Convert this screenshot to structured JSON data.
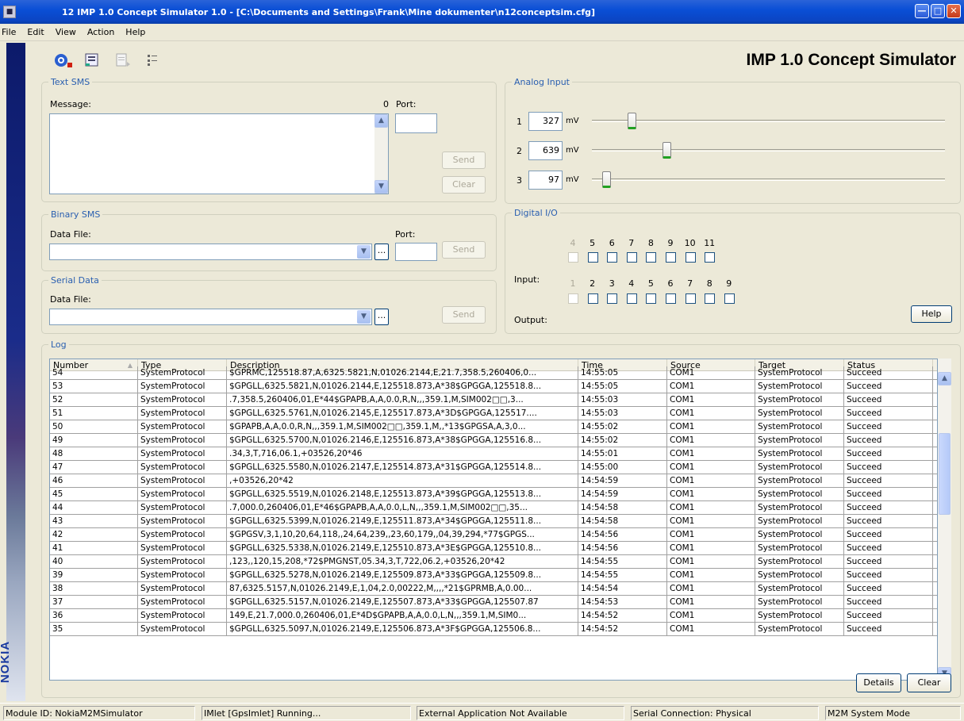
{
  "window": {
    "title": "12 IMP 1.0 Concept Simulator 1.0 - [C:\\Documents and Settings\\Frank\\Mine dokumenter\\n12conceptsim.cfg]"
  },
  "menu": [
    "File",
    "Edit",
    "View",
    "Action",
    "Help"
  ],
  "toolbar": {
    "icons": [
      "record-icon",
      "save-config-icon",
      "document-icon",
      "list-icon"
    ]
  },
  "app_heading": "IMP 1.0 Concept Simulator",
  "text_sms": {
    "legend": "Text SMS",
    "message_label": "Message:",
    "char_count": "0",
    "port_label": "Port:",
    "port_value": "",
    "message_value": "",
    "send": "Send",
    "clear": "Clear"
  },
  "binary_sms": {
    "legend": "Binary SMS",
    "data_file_label": "Data File:",
    "port_label": "Port:",
    "send": "Send",
    "dots": "..."
  },
  "serial_data": {
    "legend": "Serial Data",
    "data_file_label": "Data File:",
    "send": "Send",
    "dots": "..."
  },
  "analog_input": {
    "legend": "Analog Input",
    "unit": "mV",
    "channels": [
      {
        "id": "1",
        "value": "327",
        "level": 0.1
      },
      {
        "id": "2",
        "value": "639",
        "level": 0.2
      },
      {
        "id": "3",
        "value": "97",
        "level": 0.03
      }
    ]
  },
  "digital_io": {
    "legend": "Digital I/O",
    "input_label": "Input:",
    "output_label": "Output:",
    "input_bits": [
      "4",
      "5",
      "6",
      "7",
      "8",
      "9",
      "10",
      "11"
    ],
    "output_bits": [
      "1",
      "2",
      "3",
      "4",
      "5",
      "6",
      "7",
      "8",
      "9"
    ],
    "help": "Help"
  },
  "log": {
    "legend": "Log",
    "columns": [
      "Number",
      "Type",
      "Description",
      "Time",
      "Source",
      "Target",
      "Status"
    ],
    "rows": [
      [
        "54",
        "SystemProtocol",
        "$GPRMC,125518.87,A,6325.5821,N,01026.2144,E,21.7,358.5,260406,0...",
        "14:55:05",
        "COM1",
        "SystemProtocol",
        "Succeed"
      ],
      [
        "53",
        "SystemProtocol",
        "$GPGLL,6325.5821,N,01026.2144,E,125518.873,A*38$GPGGA,125518.8...",
        "14:55:05",
        "COM1",
        "SystemProtocol",
        "Succeed"
      ],
      [
        "52",
        "SystemProtocol",
        ".7,358.5,260406,01,E*44$GPAPB,A,A,0.0,R,N,,,359.1,M,SIM002□□,3...",
        "14:55:03",
        "COM1",
        "SystemProtocol",
        "Succeed"
      ],
      [
        "51",
        "SystemProtocol",
        "$GPGLL,6325.5761,N,01026.2145,E,125517.873,A*3D$GPGGA,125517....",
        "14:55:03",
        "COM1",
        "SystemProtocol",
        "Succeed"
      ],
      [
        "50",
        "SystemProtocol",
        "$GPAPB,A,A,0.0,R,N,,,359.1,M,SIM002□□,359.1,M,,*13$GPGSA,A,3,0...",
        "14:55:02",
        "COM1",
        "SystemProtocol",
        "Succeed"
      ],
      [
        "49",
        "SystemProtocol",
        "$GPGLL,6325.5700,N,01026.2146,E,125516.873,A*38$GPGGA,125516.8...",
        "14:55:02",
        "COM1",
        "SystemProtocol",
        "Succeed"
      ],
      [
        "48",
        "SystemProtocol",
        ".34,3,T,716,06.1,+03526,20*46",
        "14:55:01",
        "COM1",
        "SystemProtocol",
        "Succeed"
      ],
      [
        "47",
        "SystemProtocol",
        "$GPGLL,6325.5580,N,01026.2147,E,125514.873,A*31$GPGGA,125514.8...",
        "14:55:00",
        "COM1",
        "SystemProtocol",
        "Succeed"
      ],
      [
        "46",
        "SystemProtocol",
        ",+03526,20*42",
        "14:54:59",
        "COM1",
        "SystemProtocol",
        "Succeed"
      ],
      [
        "45",
        "SystemProtocol",
        "$GPGLL,6325.5519,N,01026.2148,E,125513.873,A*39$GPGGA,125513.8...",
        "14:54:59",
        "COM1",
        "SystemProtocol",
        "Succeed"
      ],
      [
        "44",
        "SystemProtocol",
        ".7,000.0,260406,01,E*46$GPAPB,A,A,0.0,L,N,,,359.1,M,SIM002□□,35...",
        "14:54:58",
        "COM1",
        "SystemProtocol",
        "Succeed"
      ],
      [
        "43",
        "SystemProtocol",
        "$GPGLL,6325.5399,N,01026.2149,E,125511.873,A*34$GPGGA,125511.8...",
        "14:54:58",
        "COM1",
        "SystemProtocol",
        "Succeed"
      ],
      [
        "42",
        "SystemProtocol",
        "$GPGSV,3,1,10,20,64,118,,24,64,239,,23,60,179,,04,39,294,*77$GPGS...",
        "14:54:56",
        "COM1",
        "SystemProtocol",
        "Succeed"
      ],
      [
        "41",
        "SystemProtocol",
        "$GPGLL,6325.5338,N,01026.2149,E,125510.873,A*3E$GPGGA,125510.8...",
        "14:54:56",
        "COM1",
        "SystemProtocol",
        "Succeed"
      ],
      [
        "40",
        "SystemProtocol",
        ",123,,120,15,208,*72$PMGNST,05.34,3,T,722,06.2,+03526,20*42",
        "14:54:55",
        "COM1",
        "SystemProtocol",
        "Succeed"
      ],
      [
        "39",
        "SystemProtocol",
        "$GPGLL,6325.5278,N,01026.2149,E,125509.873,A*33$GPGGA,125509.8...",
        "14:54:55",
        "COM1",
        "SystemProtocol",
        "Succeed"
      ],
      [
        "38",
        "SystemProtocol",
        "87,6325.5157,N,01026.2149,E,1,04,2.0,00222,M,,,,*21$GPRMB,A,0.00...",
        "14:54:54",
        "COM1",
        "SystemProtocol",
        "Succeed"
      ],
      [
        "37",
        "SystemProtocol",
        "$GPGLL,6325.5157,N,01026.2149,E,125507.873,A*33$GPGGA,125507.87",
        "14:54:53",
        "COM1",
        "SystemProtocol",
        "Succeed"
      ],
      [
        "36",
        "SystemProtocol",
        "149,E,21.7,000.0,260406,01,E*4D$GPAPB,A,A,0.0,L,N,,,359.1,M,SIM0...",
        "14:54:52",
        "COM1",
        "SystemProtocol",
        "Succeed"
      ],
      [
        "35",
        "SystemProtocol",
        "$GPGLL,6325.5097,N,01026.2149,E,125506.873,A*3F$GPGGA,125506.8...",
        "14:54:52",
        "COM1",
        "SystemProtocol",
        "Succeed"
      ]
    ],
    "details": "Details",
    "clear": "Clear"
  },
  "statusbar": [
    "Module ID: NokiaM2MSimulator",
    "IMlet [GpsImlet] Running...",
    "External Application Not Available",
    "Serial Connection: Physical",
    "M2M System Mode"
  ],
  "brand": "NOKIA"
}
